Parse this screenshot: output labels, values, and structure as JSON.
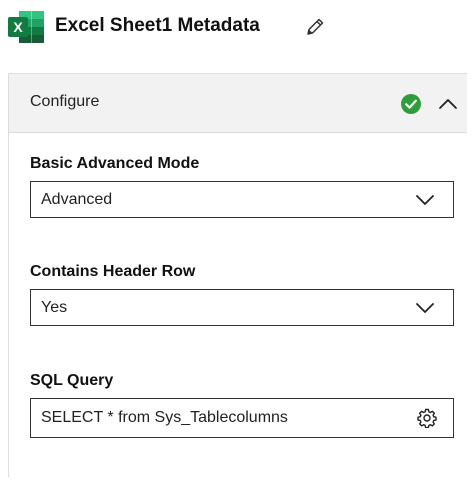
{
  "header": {
    "title": "Excel Sheet1 Metadata",
    "app_icon_letter": "X"
  },
  "configure": {
    "label": "Configure",
    "status": "complete",
    "status_color": "#2e9d3a"
  },
  "fields": {
    "mode": {
      "label": "Basic Advanced Mode",
      "value": "Advanced"
    },
    "header_row": {
      "label": "Contains Header Row",
      "value": "Yes"
    },
    "sql": {
      "label": "SQL Query",
      "value": "SELECT * from Sys_Tablecolumns"
    }
  },
  "colors": {
    "excel_green": "#1d6f42",
    "excel_green_light": "#21a366",
    "check_green": "#2e9d3a"
  }
}
